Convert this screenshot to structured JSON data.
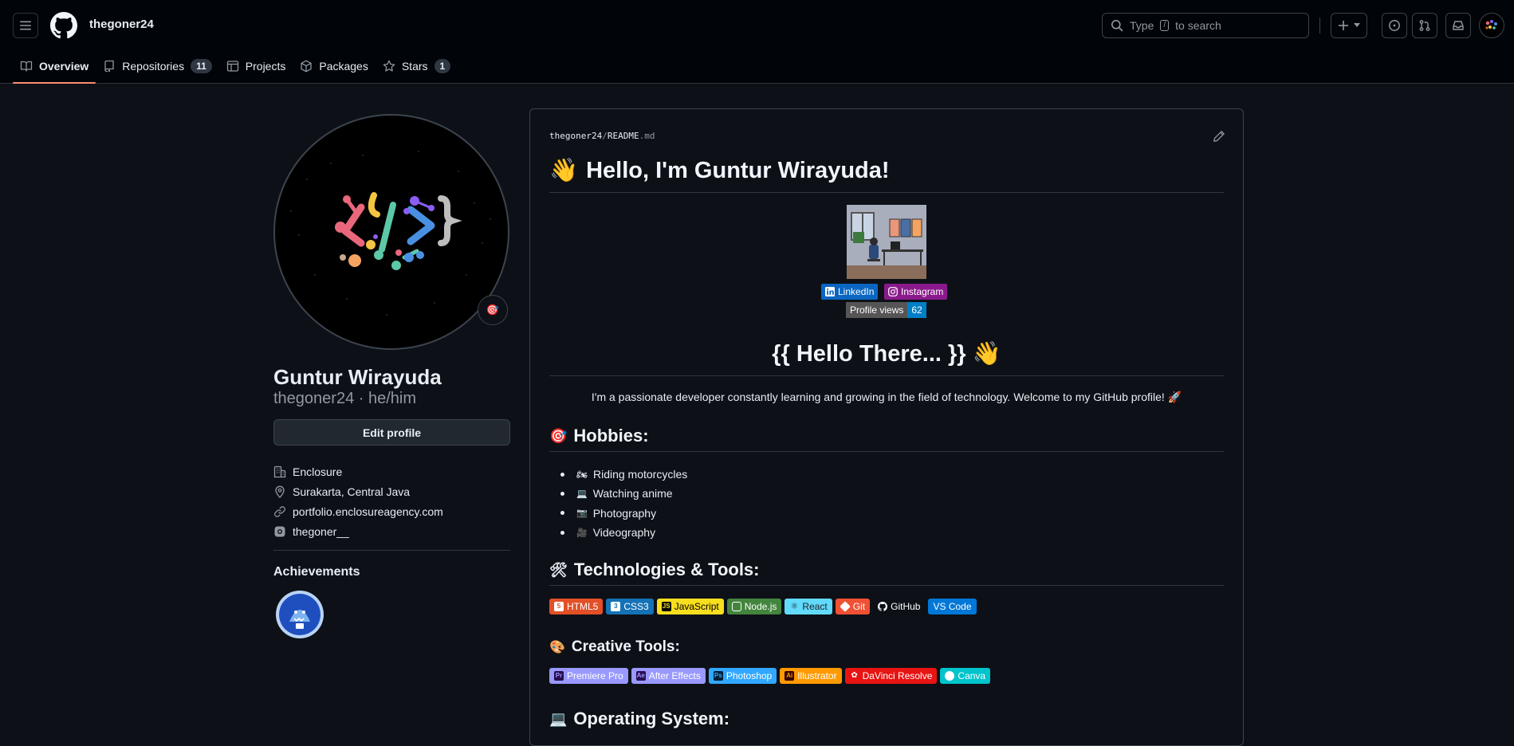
{
  "header": {
    "username": "thegoner24",
    "search_placeholder_before": "Type",
    "search_key": "/",
    "search_placeholder_after": "to search"
  },
  "tabs": [
    {
      "label": "Overview",
      "icon": "book-icon",
      "active": true
    },
    {
      "label": "Repositories",
      "icon": "repo-icon",
      "count": "11"
    },
    {
      "label": "Projects",
      "icon": "table-icon"
    },
    {
      "label": "Packages",
      "icon": "package-icon"
    },
    {
      "label": "Stars",
      "icon": "star-icon",
      "count": "1"
    }
  ],
  "profile": {
    "name": "Guntur Wirayuda",
    "login_line": "thegoner24 · he/him",
    "edit_label": "Edit profile",
    "status_emoji": "🎯",
    "company": "Enclosure",
    "location": "Surakarta, Central Java",
    "website": "portfolio.enclosureagency.com",
    "instagram": "thegoner__",
    "achievements_title": "Achievements"
  },
  "readme": {
    "path_user": "thegoner24",
    "path_sep": "/",
    "path_file": "README",
    "path_ext": ".md",
    "title_emoji": "👋",
    "title": "Hello, I'm Guntur Wirayuda!",
    "social": [
      {
        "label": "LinkedIn",
        "color": "#0a66c2"
      },
      {
        "label": "Instagram",
        "color": "#8a1a8c"
      }
    ],
    "views_label": "Profile views",
    "views_count": "62",
    "hello_heading": "{{ Hello There... }} 👋",
    "intro": "I'm a passionate developer constantly learning and growing in the field of technology. Welcome to my GitHub profile! 🚀",
    "hobbies_emoji": "🎯",
    "hobbies_title": "Hobbies:",
    "hobbies": [
      {
        "emoji": "🏍",
        "label": "Riding motorcycles"
      },
      {
        "emoji": "💻",
        "label": "Watching anime"
      },
      {
        "emoji": "📷",
        "label": "Photography"
      },
      {
        "emoji": "🎥",
        "label": "Videography"
      }
    ],
    "tech_emoji": "🛠",
    "tech_title": "Technologies & Tools:",
    "tech": [
      {
        "label": "HTML5",
        "color": "#e34f26",
        "text": "#ffffff"
      },
      {
        "label": "CSS3",
        "color": "#1572b6",
        "text": "#ffffff"
      },
      {
        "label": "JavaScript",
        "color": "#f7df1e",
        "text": "#000000"
      },
      {
        "label": "Node.js",
        "color": "#43853d",
        "text": "#ffffff"
      },
      {
        "label": "React",
        "color": "#20232a",
        "text": "#61dafb",
        "bg_override": "#61dafb"
      },
      {
        "label": "Git",
        "color": "#f05033",
        "text": "#ffffff"
      },
      {
        "label": "GitHub",
        "color": "#0d1117",
        "text": "#ffffff"
      },
      {
        "label": "VS Code",
        "color": "#0078d7",
        "text": "#ffffff"
      }
    ],
    "creative_emoji": "🎨",
    "creative_title": "Creative Tools:",
    "creative": [
      {
        "label": "Premiere Pro",
        "color": "#9999ff",
        "text": "#ffffff"
      },
      {
        "label": "After Effects",
        "color": "#9999ff",
        "text": "#ffffff"
      },
      {
        "label": "Photoshop",
        "color": "#31a8ff",
        "text": "#ffffff"
      },
      {
        "label": "Illustrator",
        "color": "#ff9a00",
        "text": "#ffffff"
      },
      {
        "label": "DaVinci Resolve",
        "color": "#e81313",
        "text": "#ffffff"
      },
      {
        "label": "Canva",
        "color": "#00c4cc",
        "text": "#ffffff"
      }
    ],
    "os_emoji": "💻",
    "os_title": "Operating System:"
  }
}
